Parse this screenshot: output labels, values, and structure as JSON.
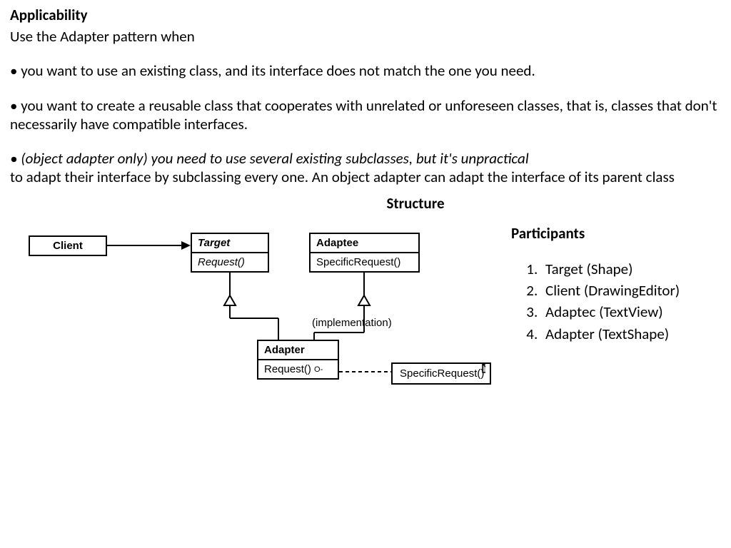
{
  "applicability": {
    "heading": "Applicability",
    "intro": "Use the Adapter pattern when",
    "bullet1": "• you want to use an existing class, and its interface does not match the one you need.",
    "bullet2": "• you want to create a reusable class that cooperates with unrelated or unforeseen classes, that is, classes that don't necessarily have compatible interfaces.",
    "bullet3_italic": "• (object adapter only) you need to use several existing subclasses, but it's unpractical",
    "bullet3_rest": "to adapt their interface by subclassing every one. An object adapter can adapt the interface of its parent class"
  },
  "structure": {
    "heading": "Structure",
    "client": "Client",
    "target": "Target",
    "target_method": "Request()",
    "adaptee": "Adaptee",
    "adaptee_method": "SpecificRequest()",
    "adapter": "Adapter",
    "adapter_method": "Request() ",
    "impl_label": "(implementation)",
    "note": "SpecificRequest()"
  },
  "participants": {
    "heading": "Participants",
    "items": [
      "Target (Shape)",
      "Client (DrawingEditor)",
      "Adaptec (TextView)",
      "Adapter (TextShape)"
    ]
  }
}
